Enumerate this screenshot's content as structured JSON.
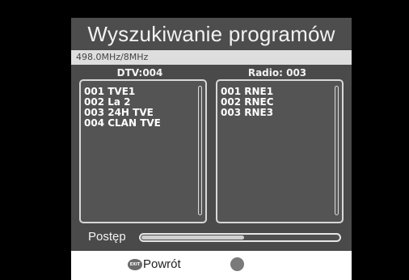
{
  "title": "Wyszukiwanie programów",
  "frequency": "498.0MHz/8MHz",
  "dtv": {
    "header": "DTV:004",
    "channels": [
      "001 TVE1",
      "002 La 2",
      "003 24H TVE",
      "004 CLAN TVE"
    ]
  },
  "radio": {
    "header": "Radio: 003",
    "channels": [
      "001 RNE1",
      "002 RNEC",
      "003 RNE3"
    ]
  },
  "progress": {
    "label": "Postęp",
    "fraction": 0.52
  },
  "footer": {
    "exit_icon": "EXIT",
    "back_label": "Powrót"
  }
}
